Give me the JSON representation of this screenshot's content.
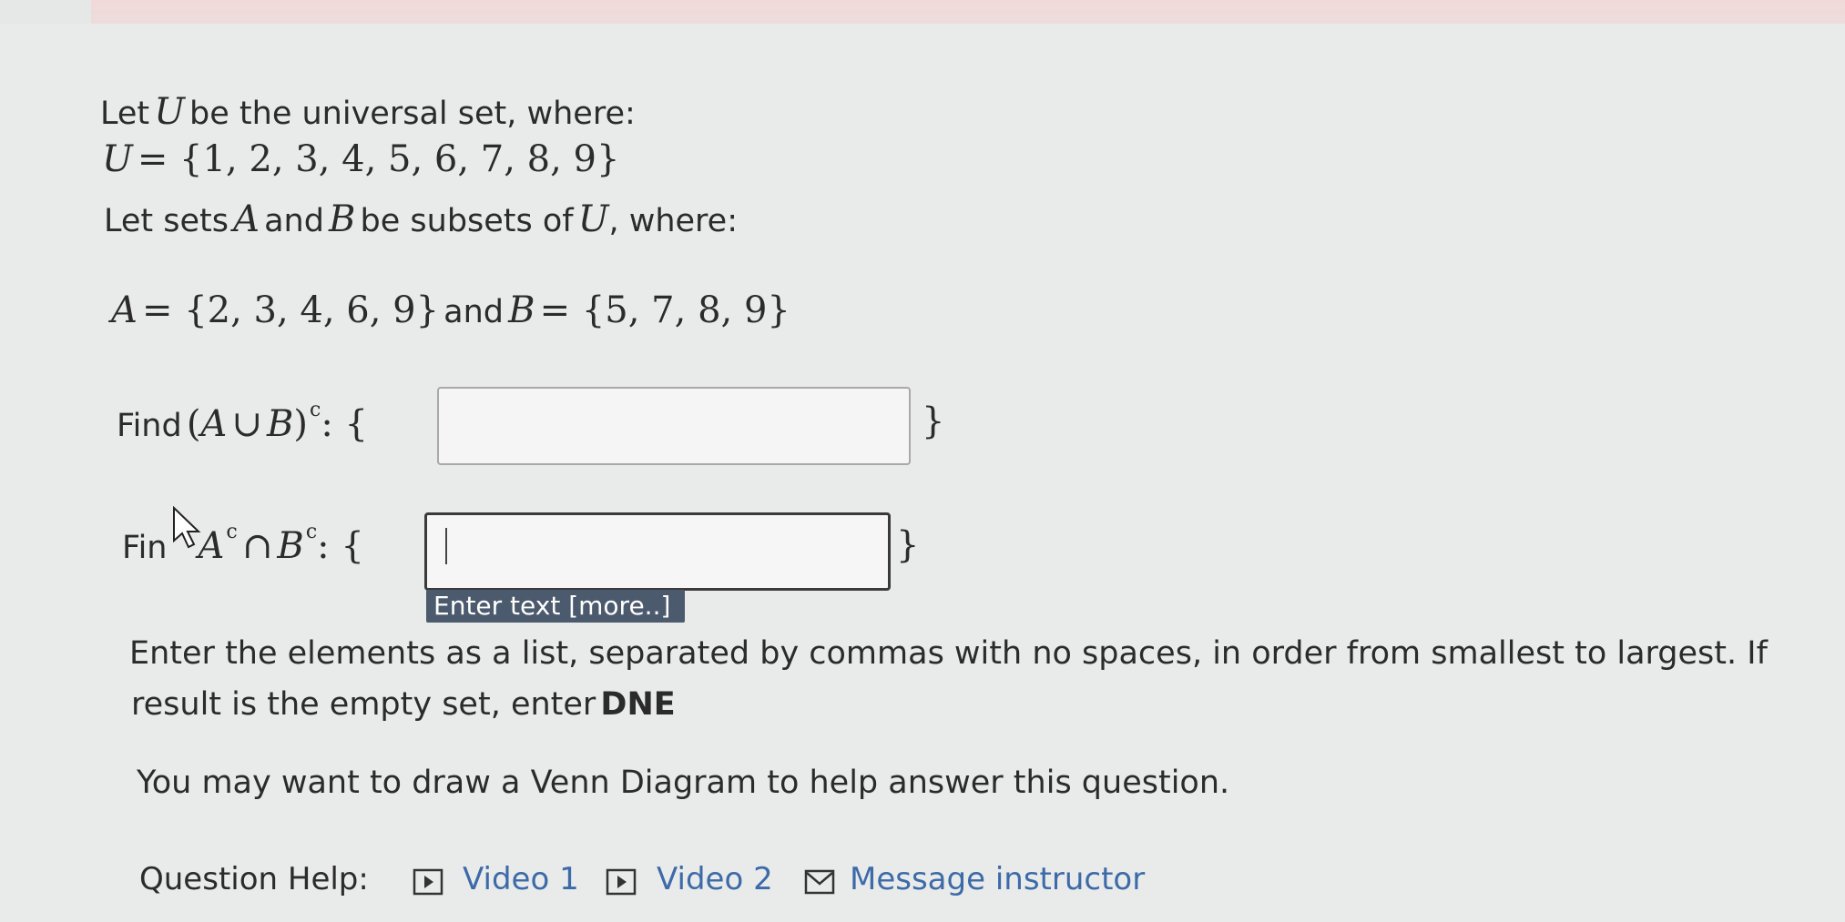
{
  "problem": {
    "line1_prefix": "Let",
    "line1_var": "U",
    "line1_suffix": "be the universal set, where:",
    "universal_var": "U",
    "universal_eq": "= {1, 2, 3, 4, 5, 6, 7, 8, 9}",
    "line3_prefix": "Let sets",
    "line3_var_a": "A",
    "line3_and": "and",
    "line3_var_b": "B",
    "line3_mid": "be subsets of",
    "line3_var_u": "U",
    "line3_suffix": ", where:",
    "set_a_var": "A",
    "set_a_eq": "= {2, 3, 4, 6, 9}",
    "sets_and": "and",
    "set_b_var": "B",
    "set_b_eq": "= {5, 7, 8, 9}"
  },
  "q1": {
    "find": "Find",
    "expr_open": "(",
    "var_a": "A",
    "union": "∪",
    "var_b": "B",
    "expr_close": ")",
    "sup": "c",
    "colon_brace": ": {",
    "close_brace": "}",
    "value": ""
  },
  "q2": {
    "find": "Fin",
    "var_a": "A",
    "sup_a": "c",
    "intersect": "∩",
    "var_b": "B",
    "sup_b": "c",
    "colon_brace": ": {",
    "close_brace": "}",
    "value": "",
    "tooltip": "Enter text [more..]"
  },
  "instructions": {
    "line1": "Enter the elements as a list, separated by commas with no spaces, in order from smallest to largest. If",
    "line2_prefix": "result is the empty set, enter",
    "line2_bold": "DNE",
    "venn_hint": "You may want to draw a Venn Diagram to help answer this question."
  },
  "help": {
    "label": "Question Help:",
    "video1": "Video 1",
    "video2": "Video 2",
    "message": "Message instructor"
  }
}
